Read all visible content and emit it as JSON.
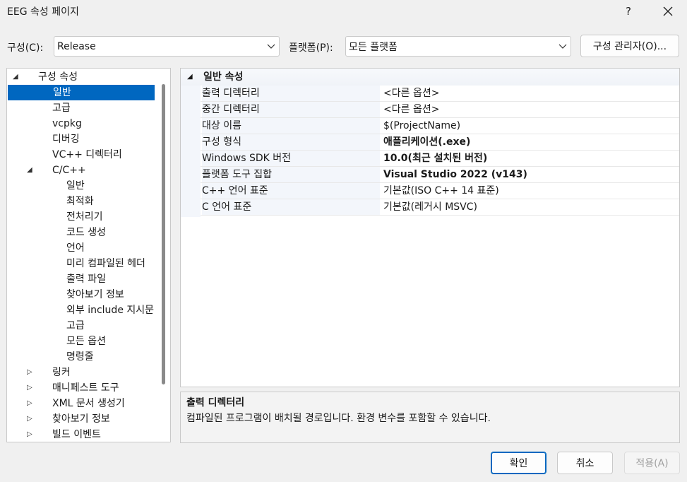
{
  "window": {
    "title": "EEG 속성 페이지",
    "help": "?"
  },
  "config": {
    "label": "구성(C):",
    "value": "Release",
    "platform_label": "플랫폼(P):",
    "platform_value": "모든 플랫폼",
    "manager_button": "구성 관리자(O)..."
  },
  "tree": {
    "items": [
      {
        "label": "구성 속성",
        "level": 0,
        "expander": "expanded"
      },
      {
        "label": "일반",
        "level": 1,
        "selected": true
      },
      {
        "label": "고급",
        "level": 1
      },
      {
        "label": "vcpkg",
        "level": 1
      },
      {
        "label": "디버깅",
        "level": 1
      },
      {
        "label": "VC++ 디렉터리",
        "level": 1
      },
      {
        "label": "C/C++",
        "level": 1,
        "expander": "expanded"
      },
      {
        "label": "일반",
        "level": 2
      },
      {
        "label": "최적화",
        "level": 2
      },
      {
        "label": "전처리기",
        "level": 2
      },
      {
        "label": "코드 생성",
        "level": 2
      },
      {
        "label": "언어",
        "level": 2
      },
      {
        "label": "미리 컴파일된 헤더",
        "level": 2
      },
      {
        "label": "출력 파일",
        "level": 2
      },
      {
        "label": "찾아보기 정보",
        "level": 2
      },
      {
        "label": "외부 include 지시문",
        "level": 2
      },
      {
        "label": "고급",
        "level": 2
      },
      {
        "label": "모든 옵션",
        "level": 2
      },
      {
        "label": "명령줄",
        "level": 2
      },
      {
        "label": "링커",
        "level": 1,
        "expander": "collapsed"
      },
      {
        "label": "매니페스트 도구",
        "level": 1,
        "expander": "collapsed"
      },
      {
        "label": "XML 문서 생성기",
        "level": 1,
        "expander": "collapsed"
      },
      {
        "label": "찾아보기 정보",
        "level": 1,
        "expander": "collapsed"
      },
      {
        "label": "빌드 이벤트",
        "level": 1,
        "expander": "collapsed"
      }
    ]
  },
  "grid": {
    "section": "일반 속성",
    "rows": [
      {
        "name": "출력 디렉터리",
        "value": "<다른 옵션>",
        "bold": false
      },
      {
        "name": "중간 디렉터리",
        "value": "<다른 옵션>",
        "bold": false
      },
      {
        "name": "대상 이름",
        "value": "$(ProjectName)",
        "bold": false
      },
      {
        "name": "구성 형식",
        "value": "애플리케이션(.exe)",
        "bold": true
      },
      {
        "name": "Windows SDK 버전",
        "value": "10.0(최근 설치된 버전)",
        "bold": true
      },
      {
        "name": "플랫폼 도구 집합",
        "value": "Visual Studio 2022 (v143)",
        "bold": true
      },
      {
        "name": "C++ 언어 표준",
        "value": "기본값(ISO C++ 14 표준)",
        "bold": false
      },
      {
        "name": "C 언어 표준",
        "value": "기본값(레거시 MSVC)",
        "bold": false
      }
    ]
  },
  "description": {
    "title": "출력 디렉터리",
    "text": "컴파일된 프로그램이 배치될 경로입니다. 환경 변수를 포함할 수 있습니다."
  },
  "buttons": {
    "ok": "확인",
    "cancel": "취소",
    "apply": "적용(A)"
  },
  "colors": {
    "selection": "#0067c0",
    "background": "#f0f0f0"
  }
}
